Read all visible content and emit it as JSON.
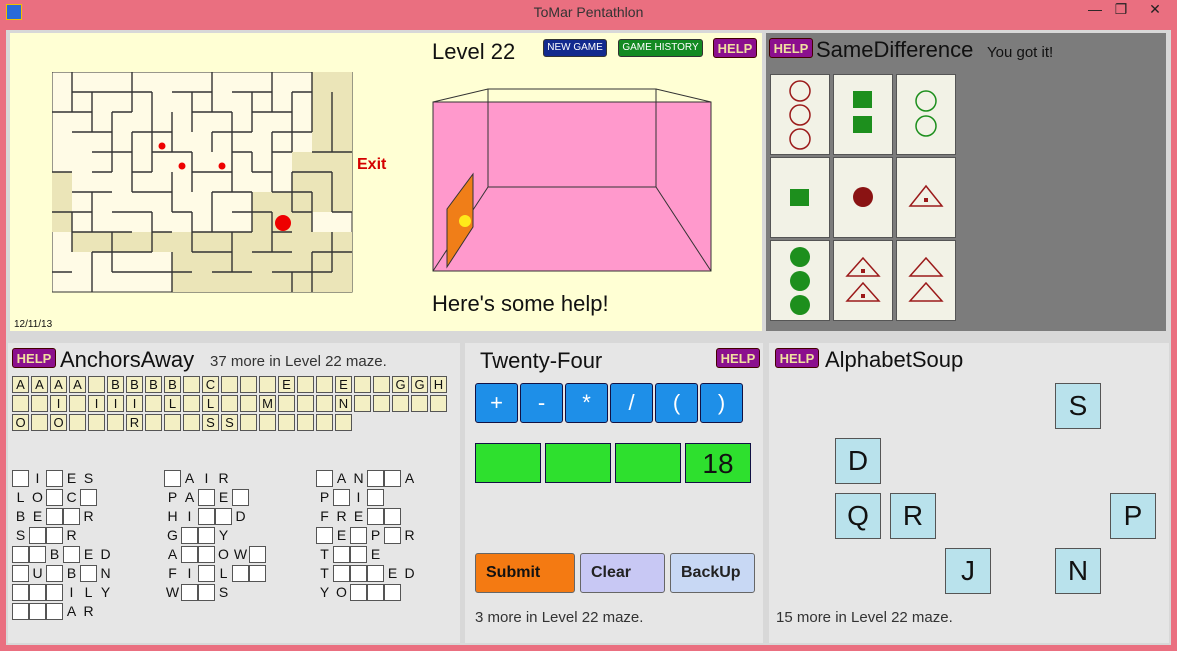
{
  "window": {
    "title": "ToMar Pentathlon",
    "min": "—",
    "max": "❐",
    "close": "✕"
  },
  "maze": {
    "level": "Level 22",
    "new_game": "NEW GAME",
    "game_history": "GAME HISTORY",
    "help": "HELP",
    "exit_label": "Exit",
    "help_text": "Here's some help!",
    "date": "12/11/13"
  },
  "same": {
    "help": "HELP",
    "title": "SameDifference",
    "status": "You got it!"
  },
  "anchors": {
    "help": "HELP",
    "title": "AnchorsAway",
    "status": "37 more in Level 22 maze.",
    "rows": [
      [
        "A",
        "A",
        "A",
        "A",
        "",
        "B",
        "B",
        "B",
        "B",
        "",
        "C",
        "",
        "",
        "",
        "E",
        "",
        "",
        "E",
        "",
        "",
        "G",
        "G",
        "H"
      ],
      [
        "",
        "",
        "I",
        "",
        "I",
        "I",
        "I",
        "",
        "L",
        "",
        "L",
        "",
        "",
        "M",
        "",
        "",
        "",
        "N",
        "",
        "",
        "",
        "",
        ""
      ],
      [
        "O",
        "",
        "O",
        "",
        "",
        "",
        "R",
        "",
        "",
        "",
        "S",
        "S",
        "",
        "",
        "",
        "",
        "",
        "",
        "",
        "",
        "",
        "",
        ""
      ]
    ],
    "words": [
      [
        "_I_ES",
        "_AIR",
        "_AN__A"
      ],
      [
        "LO_C_",
        "PA_E_",
        "P_I_"
      ],
      [
        "BE__R",
        "HI__D",
        "FRE__"
      ],
      [
        "S__R",
        "G__Y",
        "_E_P_R"
      ],
      [
        "__B_ED",
        "A__OW_",
        "T__E"
      ],
      [
        "_U_B_N",
        "FI_L__",
        "T___ED"
      ],
      [
        "___ILY",
        "W__S",
        "YO___"
      ],
      [
        "___AR",
        "",
        ""
      ]
    ]
  },
  "twentyfour": {
    "help": "HELP",
    "title": "Twenty-Four",
    "ops": [
      "+",
      "-",
      "*",
      "/",
      "(",
      ")"
    ],
    "slots": [
      "",
      "",
      "",
      "18"
    ],
    "submit": "Submit",
    "clear": "Clear",
    "backup": "BackUp",
    "status": "3 more in Level 22 maze."
  },
  "soup": {
    "help": "HELP",
    "title": "AlphabetSoup",
    "tiles": [
      "S",
      "D",
      "Q",
      "R",
      "P",
      "J",
      "N"
    ],
    "status": "15 more in Level 22 maze."
  }
}
